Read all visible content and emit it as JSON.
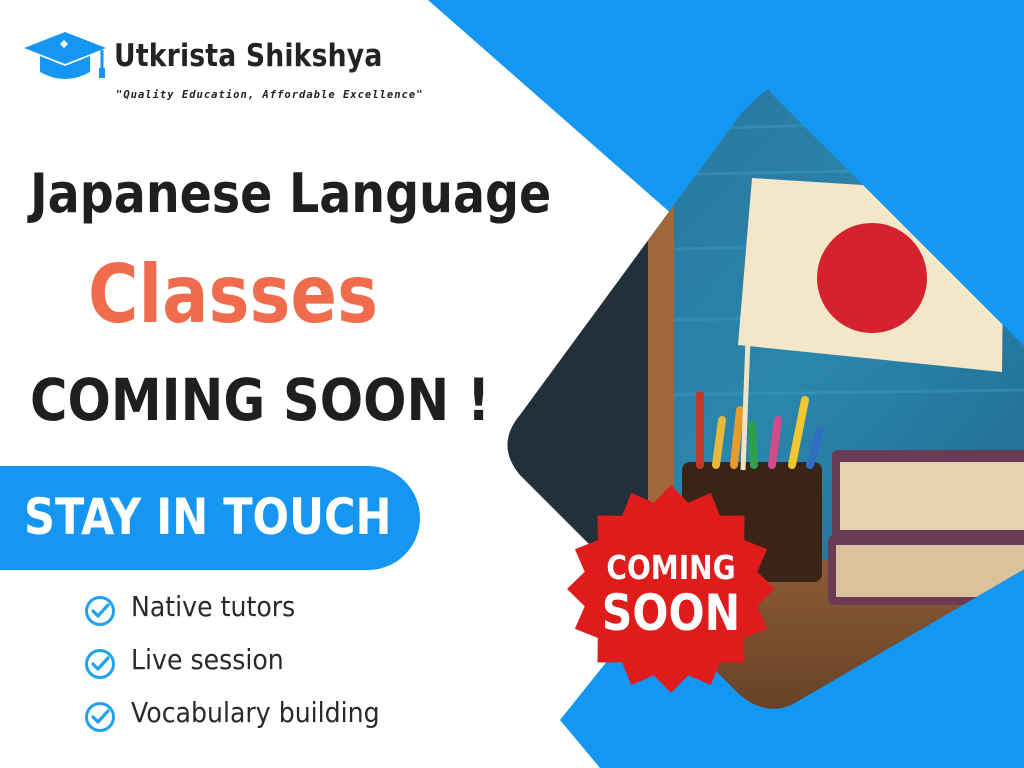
{
  "brand": {
    "logo_icon": "graduation-cap-icon",
    "name": "Utkrista Shikshya",
    "tagline": "\"Quality Education, Affordable Excellence\""
  },
  "headline": {
    "line1": "Japanese Language",
    "line2": "Classes",
    "line3": "COMING SOON !"
  },
  "cta": {
    "label": "STAY IN TOUCH"
  },
  "features": [
    {
      "icon": "check-circle-icon",
      "label": "Native tutors"
    },
    {
      "icon": "check-circle-icon",
      "label": "Live session"
    },
    {
      "icon": "check-circle-icon",
      "label": "Vocabulary building"
    }
  ],
  "badge": {
    "line1": "COMING",
    "line2": "SOON"
  },
  "colors": {
    "primary_blue": "#1496f2",
    "accent_orange": "#f06c4d",
    "badge_red": "#e01b1b",
    "heading_dark": "#1f1f1f"
  }
}
